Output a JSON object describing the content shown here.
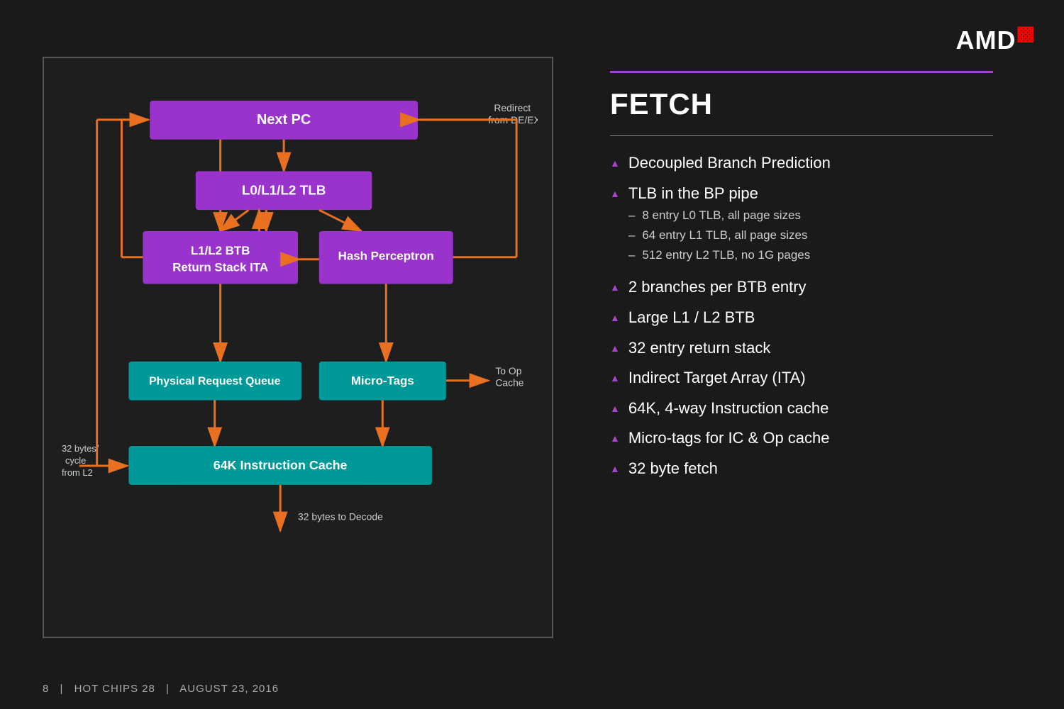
{
  "logo": {
    "text": "AMD",
    "symbol": "◣"
  },
  "footer": {
    "page": "8",
    "conference": "HOT CHIPS 28",
    "date": "AUGUST 23, 2016"
  },
  "fetch_section": {
    "title": "FETCH",
    "bullets": [
      {
        "text": "Decoupled Branch Prediction",
        "sub": []
      },
      {
        "text": "TLB in the BP pipe",
        "sub": [
          "8 entry L0 TLB, all page sizes",
          "64 entry L1 TLB, all page sizes",
          "512 entry L2 TLB, no 1G pages"
        ]
      },
      {
        "text": "2 branches per BTB entry",
        "sub": []
      },
      {
        "text": "Large L1 / L2 BTB",
        "sub": []
      },
      {
        "text": "32 entry return stack",
        "sub": []
      },
      {
        "text": "Indirect Target Array (ITA)",
        "sub": []
      },
      {
        "text": "64K, 4-way Instruction cache",
        "sub": []
      },
      {
        "text": "Micro-tags for IC & Op cache",
        "sub": []
      },
      {
        "text": "32 byte fetch",
        "sub": []
      }
    ]
  },
  "diagram": {
    "boxes": [
      {
        "id": "next-pc",
        "label": "Next PC",
        "type": "purple"
      },
      {
        "id": "tlb",
        "label": "L0/L1/L2 TLB",
        "type": "purple"
      },
      {
        "id": "btb",
        "label": "L1/L2 BTB\nReturn Stack ITA",
        "type": "purple"
      },
      {
        "id": "hash",
        "label": "Hash Perceptron",
        "type": "purple"
      },
      {
        "id": "prq",
        "label": "Physical Request Queue",
        "type": "teal"
      },
      {
        "id": "microtags",
        "label": "Micro-Tags",
        "type": "teal"
      },
      {
        "id": "icache",
        "label": "64K Instruction Cache",
        "type": "teal"
      }
    ],
    "labels": {
      "redirect": "Redirect\nfrom DE/EX",
      "to_op_cache": "To Op\nCache",
      "bytes_to_decode": "32 bytes to Decode",
      "bytes_from_l2": "32 bytes/\ncycle\nfrom L2"
    }
  }
}
